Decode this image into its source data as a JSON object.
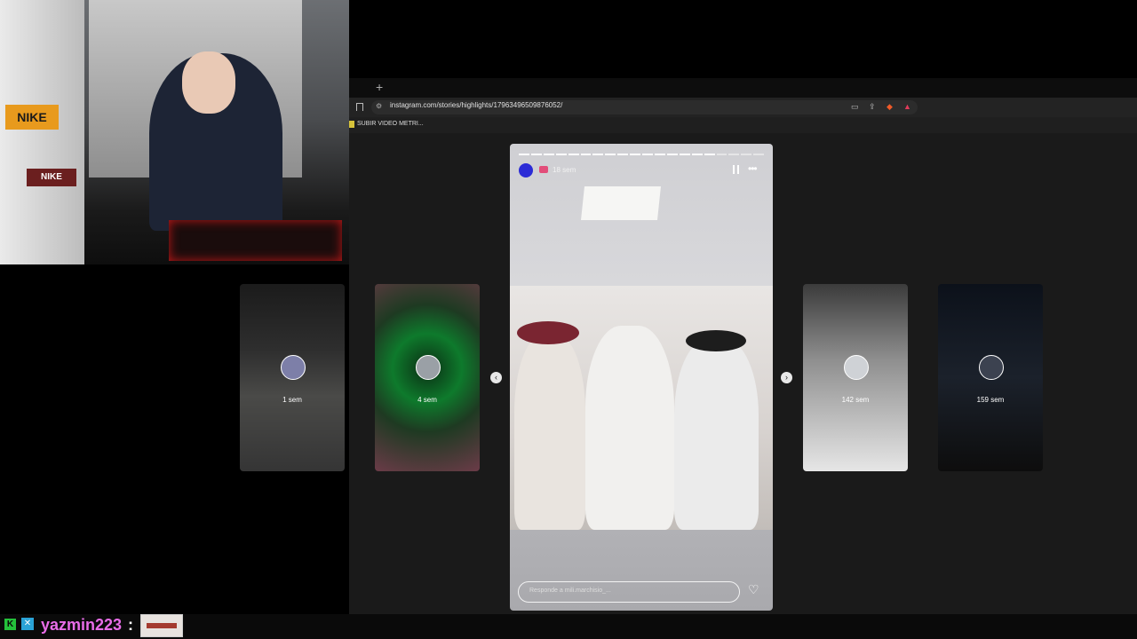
{
  "browser": {
    "new_tab_glyph": "+",
    "url": "instagram.com/stories/highlights/17963496509876052/",
    "bookmarks": [
      {
        "label": "SUBIR VIDEO METRI..."
      }
    ]
  },
  "stories": {
    "left": [
      {
        "time": "1 sem"
      },
      {
        "time": "4 sem"
      }
    ],
    "right": [
      {
        "time": "142 sem"
      },
      {
        "time": "159 sem"
      }
    ],
    "main": {
      "time": "18 sem",
      "reply_placeholder": "Responde a mili.marchisio_...",
      "progress_total": 20,
      "progress_done": 16
    }
  },
  "nav": {
    "prev_glyph": "‹",
    "next_glyph": "›"
  },
  "icons": {
    "pause": "pause-icon",
    "more": "more-icon",
    "heart": "heart-icon",
    "bookmark": "bookmark-icon",
    "site_info": "site-info-icon"
  },
  "webcam": {
    "nike_1": "NIKE",
    "nike_2": "NIKE"
  },
  "chat": {
    "username": "yazmin223",
    "separator": ":",
    "badge_1": "K",
    "badge_2": "✕"
  }
}
